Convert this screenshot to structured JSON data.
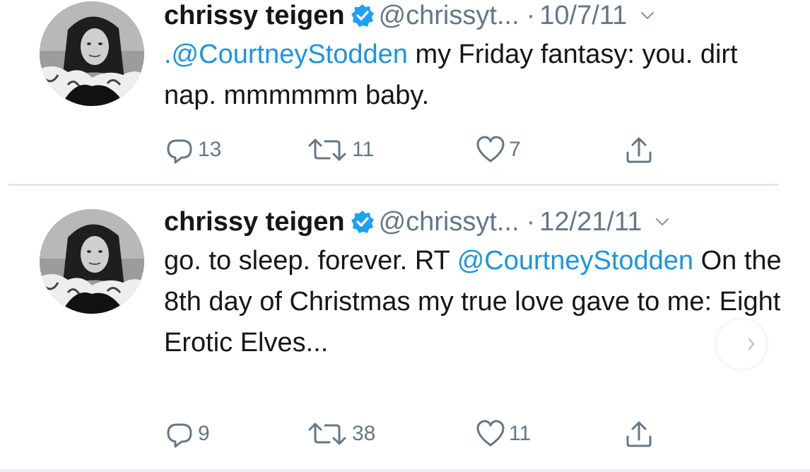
{
  "tweets": [
    {
      "name": "chrissy teigen",
      "handle": "@chrissyt...",
      "separator": "·",
      "date": "10/7/11",
      "mention": ".@CourtneyStodden",
      "text_before": "",
      "text_after": " my Friday fantasy: you. dirt nap. mmmmmm baby.",
      "reply_count": "13",
      "retweet_count": "11",
      "like_count": "7"
    },
    {
      "name": "chrissy teigen",
      "handle": "@chrissyt...",
      "separator": "·",
      "date": "12/21/11",
      "text_before": "go. to sleep. forever. RT ",
      "mention": "@CourtneyStodden",
      "text_after": " On the 8th day of Christmas my true love gave to me: Eight Erotic Elves...",
      "reply_count": "9",
      "retweet_count": "38",
      "like_count": "11"
    }
  ],
  "icons": {
    "verified": "verified-badge-icon",
    "caret": "chevron-down-icon",
    "reply": "reply-icon",
    "retweet": "retweet-icon",
    "like": "heart-icon",
    "share": "share-icon",
    "carousel": "chevron-right-icon"
  },
  "colors": {
    "mention": "#1b95e0",
    "verified": "#1da1f2",
    "muted": "#657786",
    "text": "#14171a",
    "divider": "#e1e8ed"
  }
}
